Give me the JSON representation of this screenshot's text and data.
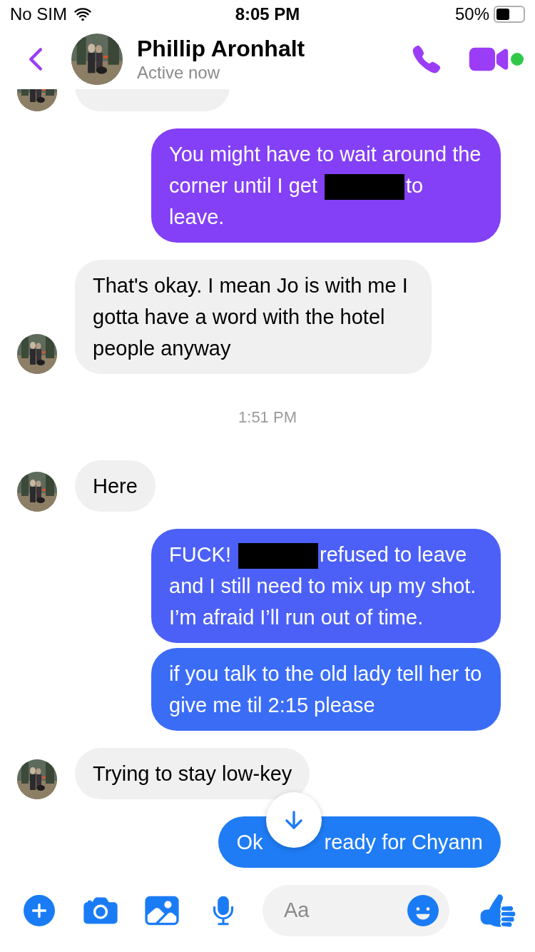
{
  "status_bar": {
    "carrier": "No SIM",
    "time": "8:05 PM",
    "battery": "50%"
  },
  "header": {
    "name": "Phillip Aronhalt",
    "status": "Active now",
    "online": true
  },
  "messages": [
    {
      "kind": "clipped_incoming",
      "avatar": true
    },
    {
      "kind": "outgoing",
      "color": "#8340f6",
      "parts": [
        {
          "kind": "text",
          "text": "You might have to wait around the corner until I get"
        },
        {
          "kind": "redaction"
        },
        {
          "kind": "text",
          "text": "to leave."
        }
      ]
    },
    {
      "kind": "incoming",
      "avatar": true,
      "parts": [
        {
          "kind": "text",
          "text": "That's okay. I mean Jo is with me I gotta have a word with the hotel people anyway"
        }
      ]
    },
    {
      "kind": "time",
      "text": "1:51 PM"
    },
    {
      "kind": "incoming",
      "avatar": true,
      "parts": [
        {
          "kind": "text",
          "text": "Here"
        }
      ]
    },
    {
      "kind": "outgoing",
      "color": "#4c60f7",
      "parts": [
        {
          "kind": "text",
          "text": "FUCK!"
        },
        {
          "kind": "redaction"
        },
        {
          "kind": "text",
          "text": "refused to leave and I still need to mix up my shot. I’m afraid I’ll run out of time."
        }
      ]
    },
    {
      "kind": "outgoing",
      "color": "#3a6cf6",
      "parts": [
        {
          "kind": "text",
          "text": "if you talk to the old lady tell her to give me til 2:15 please"
        }
      ]
    },
    {
      "kind": "incoming",
      "avatar": true,
      "parts": [
        {
          "kind": "text",
          "text": "Trying to stay low-key"
        }
      ]
    },
    {
      "kind": "outgoing",
      "color": "#1f7cf5",
      "covered": true,
      "parts": [
        {
          "kind": "text",
          "text": "Ok"
        },
        {
          "kind": "text",
          "text": "ready for Chyann"
        }
      ]
    }
  ],
  "composer": {
    "placeholder": "Aa"
  }
}
